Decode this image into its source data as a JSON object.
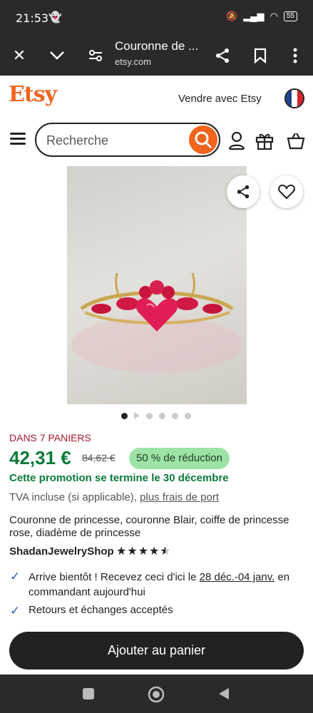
{
  "status": {
    "time": "21:53",
    "battery": "55"
  },
  "browser": {
    "page_title": "Couronne de ...",
    "domain": "etsy.com"
  },
  "header": {
    "logo": "Etsy",
    "sell_label": "Vendre avec Etsy",
    "search_placeholder": "Recherche"
  },
  "product": {
    "in_baskets": "DANS 7 PANIERS",
    "price": "42,31 €",
    "old_price": "84,62 €",
    "discount": "50 % de réduction",
    "promo_end": "Cette promotion se termine le 30 décembre",
    "tva": "TVA incluse (si applicable), ",
    "shipping_link": "plus frais de port",
    "title": "Couronne de princesse, couronne Blair, coiffe de princesse rose, diadème de princesse",
    "shop": "ShadanJewelryShop",
    "rating": 4.5,
    "delivery_prefix": "Arrive bientôt ! Recevez ceci d'ici le ",
    "delivery_dates": "28 déc.-04 janv.",
    "delivery_suffix": " en commandant aujourd'hui",
    "returns": "Retours et échanges acceptés",
    "add_to_cart": "Ajouter au panier",
    "image_count": 6
  },
  "colors": {
    "brand": "#f1641e",
    "price": "#0a7a3a",
    "badge": "#9ee3a6",
    "baskets": "#a61a2e"
  }
}
